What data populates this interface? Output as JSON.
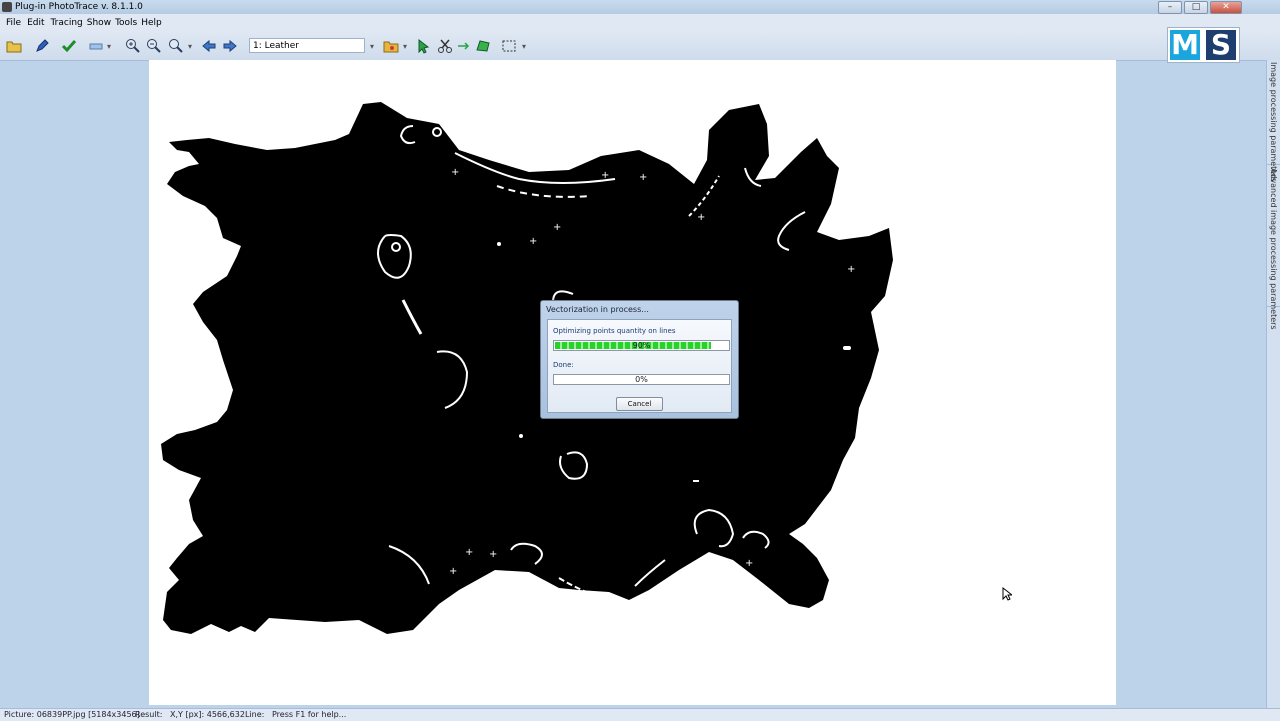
{
  "window": {
    "title": "Plug-in PhotoTrace v. 8.1.1.0"
  },
  "menu": [
    "File",
    "Edit",
    "Tracing",
    "Show",
    "Tools",
    "Help"
  ],
  "toolbar": {
    "layer_value": "1: Leather",
    "icons": [
      "open-folder-icon",
      "pencil-icon",
      "check-icon",
      "print-icon",
      "zoom-in-icon",
      "zoom-out-icon",
      "zoom-fit-icon",
      "arrow-left-icon",
      "arrow-right-icon",
      "folder-red-icon",
      "cursor-icon",
      "scissors-icon",
      "arrow-green-icon",
      "polygon-icon",
      "selection-rect-icon"
    ]
  },
  "logo": {
    "left": "M",
    "right": "S"
  },
  "side_panel": {
    "tabs": [
      "Image processing parameters",
      "Advanced image processing parameters"
    ]
  },
  "status_bar": {
    "picture": "Picture: 06839PP.jpg [5184x3456]",
    "result": "Result:",
    "coords": "X,Y [px]: 4566,632",
    "line": "Line:",
    "help": "Press F1 for help..."
  },
  "dialog": {
    "title": "Vectorization in process...",
    "step_label": "Optimizing points quantity on lines",
    "step_progress_text": "90%",
    "step_progress": 0.9,
    "done_label": "Done:",
    "done_progress_text": "0%",
    "done_progress": 0.0,
    "cancel_label": "Cancel"
  }
}
